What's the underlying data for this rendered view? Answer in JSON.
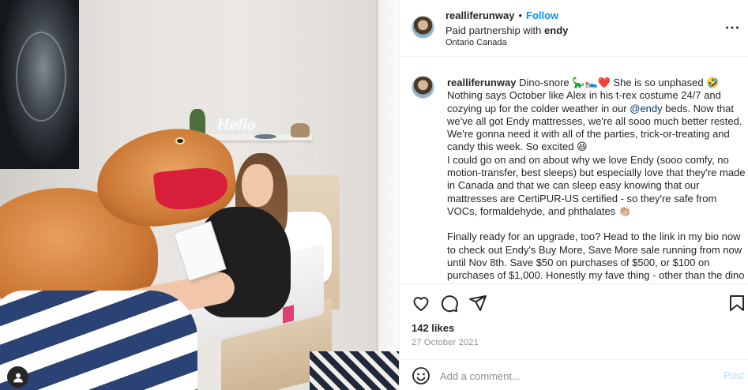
{
  "post": {
    "username": "realliferunway",
    "separator": "•",
    "follow_label": "Follow",
    "partnership_prefix": "Paid partnership with",
    "partner": "endy",
    "location": "Ontario Canada",
    "more_icon": "more-horizontal-icon"
  },
  "caption": {
    "username": "realliferunway",
    "line1": "Dino-snore 🦕🛌❤️ She is so unphased 🤣",
    "part_before_mention": "Nothing says October like Alex in his t-rex costume 24/7 and cozying up for the colder weather in our ",
    "mention": "@endy",
    "part_after_mention": " beds. Now that we've all got Endy mattresses, we're all sooo much better rested. We're gonna need it with all of the parties, trick-or-treating and candy this week. So excited 😆",
    "paragraph2": "I could go on and on about why we love Endy (sooo comfy, no motion-transfer, best sleeps) but especially love that they're made in Canada and that we can sleep easy knowing that our mattresses are CertiPUR-US certified - so they're safe from VOCs, formaldehyde, and phthalates 👏🏼",
    "paragraph3": "Finally ready for an upgrade, too? Head to the link in my bio now to check out Endy's Buy More, Save More sale running from now until Nov 8th. Save $50 on purchases of $500, or $100 on purchases of $1,000. Honestly my fave thing - other than the dino costume of course 😉"
  },
  "photo": {
    "neon_text": "Hello",
    "user_tag_icon": "user-icon"
  },
  "actions": {
    "like_icon": "heart-icon",
    "comment_icon": "comment-icon",
    "share_icon": "send-icon",
    "save_icon": "bookmark-icon"
  },
  "likes": "142 likes",
  "date": "27 October 2021",
  "comment": {
    "placeholder": "Add a comment...",
    "post_label": "Post",
    "emoji_icon": "smiley-icon"
  },
  "colors": {
    "link_blue": "#0095f6",
    "mention_blue": "#00376b",
    "post_disabled": "#b2dffc",
    "muted_gray": "#8e8e8e"
  }
}
